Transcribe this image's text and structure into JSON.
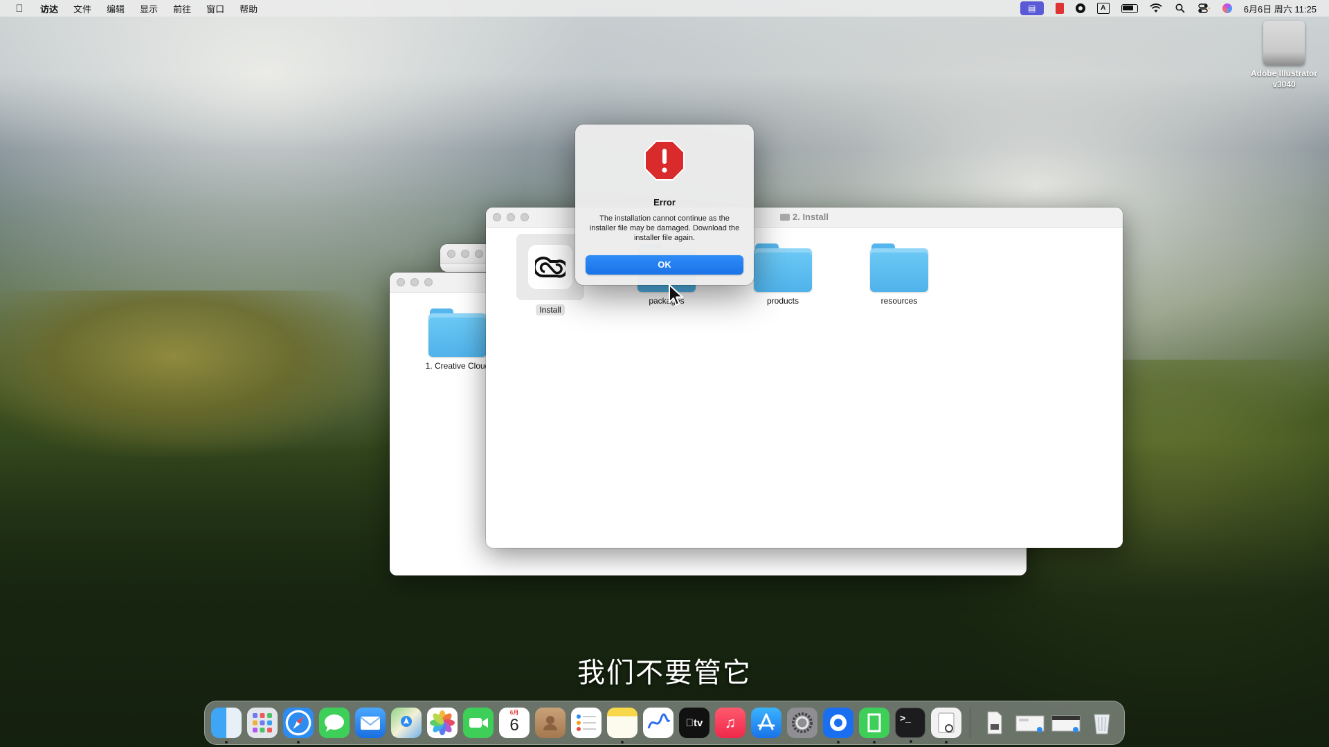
{
  "menubar": {
    "app_name": "访达",
    "items": [
      "文件",
      "编辑",
      "显示",
      "前往",
      "窗口",
      "帮助"
    ],
    "input_indicator": "A",
    "clock": "6月6日 周六 11:25"
  },
  "desktop": {
    "disk": {
      "label_line1": "Adobe Illustrator",
      "label_line2": "v3040"
    }
  },
  "windows": {
    "back": {
      "folder_label": "1. Creative Cloud"
    },
    "front": {
      "title": "2. Install",
      "items": [
        {
          "label": "Install",
          "kind": "app",
          "selected": true
        },
        {
          "label": "packages",
          "kind": "folder"
        },
        {
          "label": "products",
          "kind": "folder"
        },
        {
          "label": "resources",
          "kind": "folder"
        }
      ]
    }
  },
  "dialog": {
    "title": "Error",
    "message": "The installation cannot continue as the installer file may be damaged. Download the installer file again.",
    "ok_label": "OK",
    "icon": "alert-icon",
    "accent": "#1a73e8",
    "icon_color": "#d92b2b"
  },
  "subtitle": "我们不要管它",
  "dock": {
    "calendar_month": "6月",
    "calendar_day": "6",
    "tv_label": "tv",
    "apps": [
      "finder-icon",
      "launchpad-icon",
      "safari-icon",
      "messages-icon",
      "mail-icon",
      "maps-icon",
      "photos-icon",
      "facetime-icon",
      "calendar-icon",
      "contacts-icon",
      "reminders-icon",
      "notes-icon",
      "freeform-icon",
      "tv-icon",
      "music-icon",
      "app-store-icon",
      "system-settings-icon",
      "browser-icon",
      "facetime-alt-icon",
      "terminal-icon",
      "preview-icon",
      "file-icon",
      "screenshot-icon",
      "window-icon",
      "trash-icon"
    ]
  }
}
